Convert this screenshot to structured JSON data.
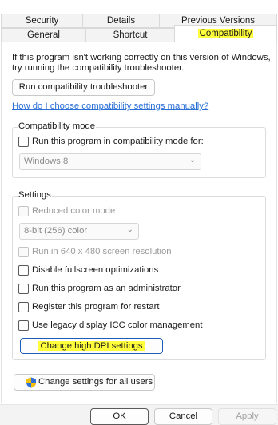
{
  "tabs": {
    "row1": [
      "Security",
      "Details",
      "Previous Versions"
    ],
    "row2": [
      "General",
      "Shortcut",
      "Compatibility"
    ],
    "active": "Compatibility"
  },
  "intro": {
    "line1": "If this program isn't working correctly on this version of Windows,",
    "line2": "try running the compatibility troubleshooter."
  },
  "troubleshooter_button": "Run compatibility troubleshooter",
  "help_link": "How do I choose compatibility settings manually?",
  "compat_mode": {
    "legend": "Compatibility mode",
    "checkbox_label": "Run this program in compatibility mode for:",
    "checked": false,
    "os_select_value": "Windows 8"
  },
  "settings": {
    "legend": "Settings",
    "reduced_color": {
      "label": "Reduced color mode",
      "checked": false,
      "disabled": true
    },
    "color_select_value": "8-bit (256) color",
    "run_640": {
      "label": "Run in 640 x 480 screen resolution",
      "checked": false,
      "disabled": true
    },
    "disable_fullscreen": {
      "label": "Disable fullscreen optimizations",
      "checked": false
    },
    "run_admin": {
      "label": "Run this program as an administrator",
      "checked": false
    },
    "register_restart": {
      "label": "Register this program for restart",
      "checked": false
    },
    "legacy_icc": {
      "label": "Use legacy display ICC color management",
      "checked": false
    },
    "dpi_button": "Change high DPI settings"
  },
  "all_users_button": "Change settings for all users",
  "footer": {
    "ok": "OK",
    "cancel": "Cancel",
    "apply": "Apply"
  },
  "colors": {
    "highlight": "#ffff3b",
    "link": "#2a6fd6",
    "shield_blue": "#2f6fd8",
    "shield_yellow": "#f2c200"
  }
}
